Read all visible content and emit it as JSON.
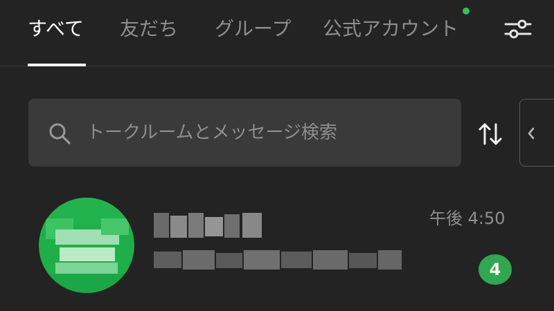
{
  "tabs": [
    {
      "label": "すべて",
      "active": true
    },
    {
      "label": "友だち",
      "active": false
    },
    {
      "label": "グループ",
      "active": false
    },
    {
      "label": "公式アカウント",
      "active": false,
      "notification_dot": true
    }
  ],
  "search": {
    "placeholder": "トークルームとメッセージ検索",
    "value": ""
  },
  "icons": {
    "filter": "sliders-icon",
    "search": "search-icon",
    "sort": "sort-icon",
    "collapse": "chevron-left-icon"
  },
  "chat_list": [
    {
      "name": "",
      "preview": "",
      "time": "午後 4:50",
      "unread": "4",
      "blurred": true
    }
  ],
  "colors": {
    "background": "#232323",
    "search_bg": "#3a3a3a",
    "accent_green": "#2fc15b",
    "badge_green": "#2fa84f",
    "text_muted": "#8e8e8e",
    "text_active": "#ffffff"
  }
}
